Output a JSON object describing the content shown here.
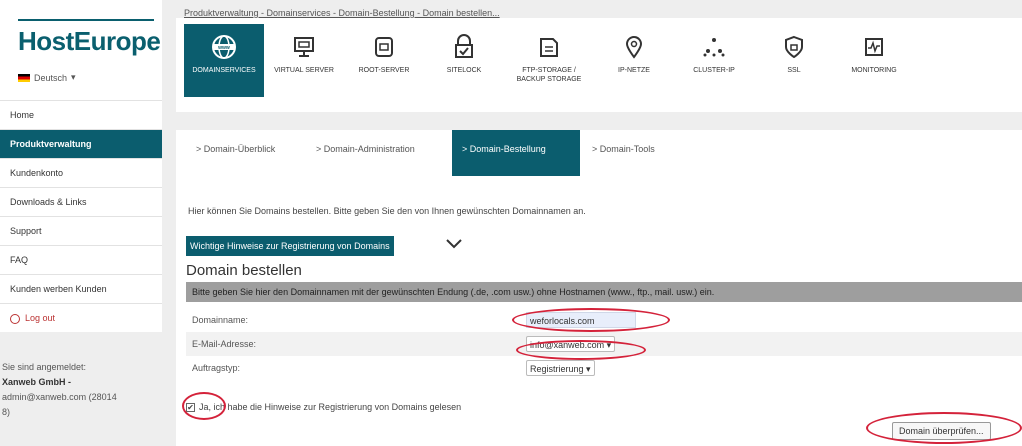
{
  "brand": {
    "logo": "HostEurope",
    "language": "Deutsch"
  },
  "sidebar": {
    "items": [
      {
        "label": "Home",
        "active": false
      },
      {
        "label": "Produktverwaltung",
        "active": true
      },
      {
        "label": "Kundenkonto",
        "active": false
      },
      {
        "label": "Downloads & Links",
        "active": false
      },
      {
        "label": "Support",
        "active": false
      },
      {
        "label": "FAQ",
        "active": false
      },
      {
        "label": "Kunden werben Kunden",
        "active": false
      },
      {
        "label": "Log out",
        "active": false
      }
    ],
    "login_line1": "Sie sind angemeldet:",
    "login_user": "Xanweb GmbH -",
    "login_email": "admin@xanweb.com (28014",
    "login_id_tail": "8)"
  },
  "breadcrumb": {
    "text": "Produktverwaltung - Domainservices - Domain-Bestellung - Domain bestellen..."
  },
  "services": [
    {
      "label": "DOMAINSERVICES",
      "icon": "globe-icon",
      "active": true
    },
    {
      "label": "VIRTUAL SERVER",
      "icon": "monitor-icon",
      "active": false
    },
    {
      "label": "ROOT-SERVER",
      "icon": "server-icon",
      "active": false
    },
    {
      "label": "SITELOCK",
      "icon": "lock-icon",
      "active": false
    },
    {
      "label": "FTP-STORAGE /\nBACKUP STORAGE",
      "icon": "storage-icon",
      "active": false
    },
    {
      "label": "IP-NETZE",
      "icon": "location-pin-icon",
      "active": false
    },
    {
      "label": "CLUSTER-IP",
      "icon": "cluster-icon",
      "active": false
    },
    {
      "label": "SSL",
      "icon": "shield-icon",
      "active": false
    },
    {
      "label": "MONITORING",
      "icon": "monitoring-icon",
      "active": false
    }
  ],
  "subtabs": [
    {
      "label": "> Domain-Überblick",
      "active": false
    },
    {
      "label": "> Domain-Administration",
      "active": false
    },
    {
      "label": "> Domain-Bestellung",
      "active": true
    },
    {
      "label": "> Domain-Tools",
      "active": false
    }
  ],
  "content": {
    "intro": "Hier können Sie Domains bestellen. Bitte geben Sie den von Ihnen gewünschten Domainnamen an.",
    "hints_label": "Wichtige Hinweise zur Registrierung von Domains",
    "form_title": "Domain bestellen",
    "form_header": "Bitte geben Sie hier den Domainnamen mit der gewünschten Endung (.de, .com usw.) ohne Hostnamen (www., ftp., mail. usw.) ein.",
    "fields": {
      "domain_label": "Domainname:",
      "domain_value": "weforlocals.com",
      "email_label": "E-Mail-Adresse:",
      "email_value": "info@xanweb.com ▾",
      "order_label": "Auftragstyp:",
      "order_value": "Registrierung ▾"
    },
    "confirm_text": "Ja, ich habe die Hinweise zur Registrierung von Domains gelesen",
    "check_button": "Domain überprüfen..."
  },
  "colors": {
    "brand": "#0b5d6e",
    "annotation": "#d4223a",
    "header_gray": "#9e9e9e"
  }
}
